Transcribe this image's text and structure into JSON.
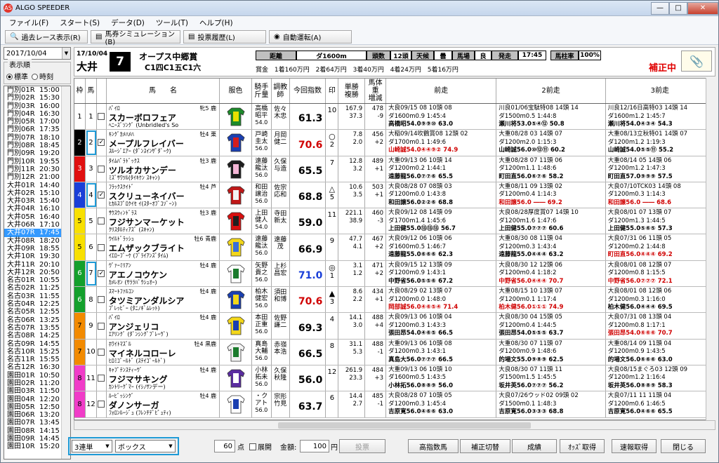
{
  "app": {
    "title": "ALGO SPEEDER",
    "icon": "AS"
  },
  "menu": [
    "ファイル(F)",
    "スタート(S)",
    "データ(D)",
    "ツール(T)",
    "ヘルプ(H)"
  ],
  "toolbar": [
    "過去レース表示(R)",
    "馬券シミュレーション(B)",
    "投票履歴(L)",
    "自動運転(A)"
  ],
  "date": "2017/10/04",
  "order": {
    "label": "表示順",
    "opt1": "標準",
    "opt2": "時刻"
  },
  "races": [
    {
      "c": "門別01R",
      "t": "15:00"
    },
    {
      "c": "門別02R",
      "t": "15:30"
    },
    {
      "c": "門別03R",
      "t": "16:00"
    },
    {
      "c": "門別04R",
      "t": "16:30"
    },
    {
      "c": "門別05R",
      "t": "17:00"
    },
    {
      "c": "門別06R",
      "t": "17:35"
    },
    {
      "c": "門別07R",
      "t": "18:10"
    },
    {
      "c": "門別08R",
      "t": "18:45"
    },
    {
      "c": "門別09R",
      "t": "19:20"
    },
    {
      "c": "門別10R",
      "t": "19:55"
    },
    {
      "c": "門別11R",
      "t": "20:30"
    },
    {
      "c": "門別12R",
      "t": "21:00"
    },
    {
      "c": "大井01R",
      "t": "14:40"
    },
    {
      "c": "大井02R",
      "t": "15:10"
    },
    {
      "c": "大井03R",
      "t": "15:40"
    },
    {
      "c": "大井04R",
      "t": "16:10"
    },
    {
      "c": "大井05R",
      "t": "16:40"
    },
    {
      "c": "大井06R",
      "t": "17:10"
    },
    {
      "c": "大井07R",
      "t": "17:45"
    },
    {
      "c": "大井08R",
      "t": "18:20"
    },
    {
      "c": "大井09R",
      "t": "18:55"
    },
    {
      "c": "大井10R",
      "t": "19:30"
    },
    {
      "c": "大井11R",
      "t": "20:10"
    },
    {
      "c": "大井12R",
      "t": "20:50"
    },
    {
      "c": "名古01R",
      "t": "10:55"
    },
    {
      "c": "名古02R",
      "t": "11:25"
    },
    {
      "c": "名古03R",
      "t": "11:55"
    },
    {
      "c": "名古04R",
      "t": "12:25"
    },
    {
      "c": "名古05R",
      "t": "12:55"
    },
    {
      "c": "名古06R",
      "t": "13:25"
    },
    {
      "c": "名古07R",
      "t": "13:55"
    },
    {
      "c": "名古08R",
      "t": "14:25"
    },
    {
      "c": "名古09R",
      "t": "14:55"
    },
    {
      "c": "名古10R",
      "t": "15:25"
    },
    {
      "c": "名古11R",
      "t": "15:55"
    },
    {
      "c": "名古12R",
      "t": "16:30"
    },
    {
      "c": "園田01R",
      "t": "10:50"
    },
    {
      "c": "園田02R",
      "t": "11:20"
    },
    {
      "c": "園田03R",
      "t": "11:50"
    },
    {
      "c": "園田04R",
      "t": "12:20"
    },
    {
      "c": "園田05R",
      "t": "12:50"
    },
    {
      "c": "園田06R",
      "t": "13:20"
    },
    {
      "c": "園田07R",
      "t": "13:45"
    },
    {
      "c": "園田08R",
      "t": "14:15"
    },
    {
      "c": "園田09R",
      "t": "14:45"
    },
    {
      "c": "園田10R",
      "t": "15:20"
    }
  ],
  "selected_race": "大井07R",
  "race": {
    "date": "17/10/04",
    "venue": "大井",
    "number": "7",
    "name": "オープス中郷賞",
    "cls": "C1四C1五C1六",
    "dist_lbl": "距離",
    "dist": "ダ1600m",
    "heads_lbl": "頭数",
    "heads": "12頭",
    "weather_lbl": "天候",
    "weather": "曇",
    "track_lbl": "馬場",
    "track": "良",
    "start_lbl": "発走",
    "start": "17:45",
    "rate_lbl": "馬柱率",
    "rate": "100%",
    "prize": "賞金 1着160万円 2着64万円 3着40万円 4着24万円 5着16万円",
    "status": "補正中"
  },
  "columns": [
    "枠",
    "馬",
    "",
    "馬　　名",
    "服色",
    "騎手\n斤量",
    "調教師",
    "今回指数",
    "印",
    "単勝\n複勝",
    "馬体重\n増減",
    "前走",
    "2前走",
    "3前走"
  ],
  "horses": [
    {
      "f": "1",
      "n": "1",
      "ck": false,
      "sire": "ﾊﾟｲﾛ",
      "sex": "牝5 鹿",
      "name": "スカーボロフェア",
      "dam": "ﾍﾆｰｽﾞｿﾝｸﾞ (Unbridled's So",
      "j": "高橋\n昭平",
      "w": "54.0",
      "t": "佐々\n木忠",
      "idx": "61.3",
      "mk": "",
      "pop": "10",
      "od1": "167.9",
      "od2": "37.3",
      "bw": "478",
      "bd": "-9",
      "p1a": "大良09/15 08 10頭 08",
      "p1b": "ダ1600m0.9 1:45:4",
      "p1c": "高橋昭54.0⑨⑨⑩ 63.0",
      "p2a": "川良01/06宝駄特08 14頭 14",
      "p2b": "ダ1500m0.5 1:44:8",
      "p2c": "瀬川将53.0⑤④⑫ 50.8",
      "p3a": "川良12/16日高特03 14頭 14",
      "p3b": "ダ1600m1.2 1:45:7",
      "p3c": "瀬川将54.0④③④ 54.3",
      "c1": "",
      "c2": "",
      "c3": "",
      "silk": [
        "#1d8a2a",
        "#e8e000"
      ]
    },
    {
      "f": "2",
      "n": "2",
      "ck": true,
      "sire": "ｷﾝｸﾞｶﾒﾊﾒﾊ",
      "sex": "牡4 栗",
      "name": "メープルフレイバー",
      "dam": "ｽﾙｰｼﾞｴｱｰ (ﾀﾞﾝｽｲﾝｻﾞﾀﾞｰｸ)",
      "j": "戸崎\n圭太",
      "w": "56.0",
      "t": "月岡\n健二",
      "idx": "70.6",
      "mk": "○",
      "pop": "2",
      "od1": "7.8",
      "od2": "2.0",
      "bw": "456",
      "bd": "+2",
      "p1a": "大稲09/14吹鶴賞08 12頭 02",
      "p1b": "ダ1700m0.1 1:49:6",
      "p1c": "山崎誠54.0④④⑨② 74.9",
      "p2a": "大重08/28 03 14頭 07",
      "p2b": "ダ1200m2.0 1:15:3",
      "p2c": "山崎誠56.0⑩⑫⑪ 60.2",
      "p3a": "大重08/13立秋特01 14頭 07",
      "p3b": "ダ1200m1.2 1:19:3",
      "p3c": "山崎誠54.0⑤⑤⑪ 55.2",
      "c1": "red",
      "c2": "",
      "c3": "",
      "silk": [
        "#1a3fb0",
        "#d31d1d"
      ]
    },
    {
      "f": "3",
      "n": "3",
      "ck": false,
      "sire": "ﾀｲﾑﾊﾟﾗﾄﾞｯｸｽ",
      "sex": "牡3 鹿",
      "name": "ツルオカサンデー",
      "dam": "ﾐｽﾞｻﾜﾂﾙ(ﾀｲｷｹﾝ ｽｷｬﾝ)",
      "j": "遠藤\n龍汰",
      "w": "56.0",
      "t": "久保\n与造",
      "idx": "65.5",
      "mk": "",
      "pop": "7",
      "od1": "12.8",
      "od2": "3.2",
      "bw": "489",
      "bd": "+1",
      "p1a": "大重09/13 06 10頭 14",
      "p1b": "ダ1200m0.2 1:44:1",
      "p1c": "遠藤龍56.0⑦⑦⑥ 65.5",
      "p2a": "大重08/28 07 11頭 06",
      "p2b": "ダ1200m1.1 1:48:6",
      "p2c": "町田直56.0⑥⑦⑥ 58.2",
      "p3a": "大重08/14 05 14頭 06",
      "p3b": "ダ1200m1.2 1:47:3",
      "p3c": "町田直57.0⑨⑨⑨ 57.5",
      "c1": "",
      "c2": "",
      "c3": "",
      "silk": [
        "#1d1d1d",
        "#f4b6d6"
      ]
    },
    {
      "f": "4",
      "n": "4",
      "ck": true,
      "sire": "ﾌﾗｯｸｽｸｲﾄﾞ",
      "sex": "牡4 芦",
      "name": "スクリューネイバー",
      "dam": "ﾋｶﾙｽﾌﾟﾛｸｲｾ ｲ(ｽﾀｰｵﾌﾞｺｿﾞｰﾝ)",
      "j": "和田\n譲治",
      "w": "56.0",
      "t": "佐宗\n応和",
      "idx": "68.8",
      "mk": "△",
      "pop": "5",
      "od1": "10.6",
      "od2": "3.5",
      "bw": "503",
      "bd": "+1",
      "p1a": "大良08/28 07 08頭 03",
      "p1b": "ダ1200m0.0 1:43:8",
      "p1c": "和田譲56.0②②⑥ 68.8",
      "p2a": "大重08/11 09 13頭 02",
      "p2b": "ダ1200m0.4 1:14:3",
      "p2c": "和田譲56.0 ―― 69.2",
      "p3a": "大良07/10TCK03 14頭 08",
      "p3b": "ダ1200m0.3 1:14:3",
      "p3c": "和田譲56.0 ―― 68.6",
      "c1": "",
      "c2": "red",
      "c3": "red",
      "silk": [
        "#c01818",
        "#f2f2f2"
      ]
    },
    {
      "f": "5",
      "n": "5",
      "ck": false,
      "sire": "ｻｳｽｳｨﾝﾄﾞﾗｽ",
      "sex": "牡3 鹿",
      "name": "フジサンマーケット",
      "dam": "ｸﾘｽﾀﾙﾃｨｱｽﾞ (ｽｷｬﾝ)",
      "j": "上田\n健人",
      "w": "54.0",
      "t": "寺田\n新太",
      "idx": "59.0",
      "mk": "",
      "pop": "11",
      "od1": "221.1",
      "od2": "38.9",
      "bw": "460",
      "bd": "-3",
      "p1a": "大良09/12 08 14頭 09",
      "p1b": "ダ1700m1.4 1:45:6",
      "p1c": "上田健55.0⑬⑬⑬ 56.7",
      "p2a": "大良08/28厚度賞07 14頭 10",
      "p2b": "ダ1200m1.6 1:47:6",
      "p2c": "上田健55.0⑦⑦⑦ 60.6",
      "p3a": "大良08/01 07 13頭 07",
      "p3b": "ダ1200m1.3 1:44:5",
      "p3c": "上田健55.0⑤⑥⑤ 57.3",
      "c1": "",
      "c2": "",
      "c3": "",
      "silk": [
        "#d81010",
        "#202020"
      ]
    },
    {
      "f": "5",
      "n": "6",
      "ck": false,
      "sire": "ｳｲﾙﾄﾞﾗｯｼｭ",
      "sex": "牡6 青鹿",
      "name": "エムザックブライト",
      "dam": "ｲｴﾛｰﾌﾞｰｹ (ﾌﾞﾗｲｱﾝｽﾞﾀｲﾑ)",
      "j": "遠藤\n龍汰",
      "w": "56.0",
      "t": "遠藤\n茂",
      "idx": "66.9",
      "mk": "",
      "pop": "9",
      "od1": "47.7",
      "od2": "4.1",
      "bw": "467",
      "bd": "+2",
      "p1a": "大良09/12 06 10頭 06",
      "p1b": "ダ1600m0.5 1:46:7",
      "p1c": "遠藤龍55.0⑥⑥⑥ 62.3",
      "p2a": "大重08/30 08 11頭 04",
      "p2b": "ダ1200m0.3 1:43:4",
      "p2c": "遠藤龍55.0④④④ 63.2",
      "p3a": "大良07/31 06 11頭 05",
      "p3b": "ダ1200m0.2 1:44:8",
      "p3c": "町田直56.0④④④ 69.2",
      "c1": "",
      "c2": "",
      "c3": "red",
      "silk": [
        "#f2d61a",
        "#3a6fd8"
      ]
    },
    {
      "f": "6",
      "n": "7",
      "ck": true,
      "sire": "ｳﾞｧｰﾐﾘｱﾝ",
      "sex": "牡4 鹿",
      "name": "アエノコウケン",
      "dam": "ｶﾒﾚｵﾝ (ｻﾗﾗﾊﾞｳｼｭｵｰ)",
      "j": "矢野\n貴之",
      "w": "56.0",
      "t": "上杉\n昌宏",
      "idx": "71.0",
      "mk": "◎",
      "pop": "1",
      "od1": "3.1",
      "od2": "1.2",
      "bw": "471",
      "bd": "+2",
      "p1a": "大良09/15 12 13頭 09",
      "p1b": "ダ1200m0.9 1:43:1",
      "p1c": "中野省56.0⑤⑤⑥ 67.2",
      "p2a": "大良08/30 12 12頭 06",
      "p2b": "ダ1200m0.4 1:18:2",
      "p2c": "中野省56.0④④④ 70.7",
      "p3a": "大良08/01 08 12頭 07",
      "p3b": "ダ1200m0.8 1:15:5",
      "p3c": "中野省56.0⑦⑦⑦ 72.1",
      "c1": "",
      "c2": "red",
      "c3": "red",
      "silk": [
        "#ffffff",
        "#1b7b2d"
      ]
    },
    {
      "f": "6",
      "n": "8",
      "ck": false,
      "sire": "ｽﾏｰﾄﾌｧﾙｺﾝ",
      "sex": "牡4 鹿",
      "name": "タツミアンダルシア",
      "dam": "ﾌﾟﾚｯﾋﾞｰ (ﾀﾆﾉｷﾞﾑﾚｯﾄ)",
      "j": "柏木\n健宏",
      "w": "56.0",
      "t": "須田\n和博",
      "idx": "70.6",
      "mk": "▲",
      "pop": "3",
      "od1": "8.6",
      "od2": "2.2",
      "bw": "434",
      "bd": "+1",
      "p1a": "大良08/29 02 13頭 07",
      "p1b": "ダ1200m0.0 1:48:0",
      "p1c": "岡部誠56.0④⑥⑤④ 71.4",
      "p2a": "大重08/15 10 13頭 07",
      "p2b": "ダ1200m0.1 1:17:4",
      "p2c": "柏木健56.0①①① 74.9",
      "p3a": "大良08/01 08 12頭 06",
      "p3b": "ダ1200m0.3 1:16:0",
      "p3c": "柏木健56.0④④④ 69.5",
      "c1": "red",
      "c2": "red",
      "c3": "",
      "silk": [
        "#1a3fb0",
        "#f2d61a"
      ]
    },
    {
      "f": "7",
      "n": "9",
      "ck": false,
      "sire": "ﾊﾟｲﾛ",
      "sex": "牡4 鹿",
      "name": "アンジェリコ",
      "dam": "ｴｱﾘﾝｸﾞ (ﾀﾞﾝｼﾝｸﾞﾌﾞﾚｰｳﾞ)",
      "j": "本田\n正重",
      "w": "56.0",
      "t": "佐野\n謙二",
      "idx": "69.3",
      "mk": "",
      "pop": "4",
      "od1": "14.1",
      "od2": "3.0",
      "bw": "488",
      "bd": "+4",
      "p1a": "大良09/13 06 10頭 04",
      "p1b": "ダ1200m0.3 1:43:3",
      "p1c": "張田昂54.0④⑥⑤ 66.5",
      "p2a": "大良08/30 04 15頭 05",
      "p2b": "ダ1200m0.4 1:44:5",
      "p2c": "張田昂54.0⑤⑤⑤ 63.7",
      "p3a": "大良07/31 08 13頭 04",
      "p3b": "ダ1200m0.8 1:17:1",
      "p3c": "張田昂54.0⑥⑥⑥ 70.7",
      "c1": "",
      "c2": "",
      "c3": "red",
      "silk": [
        "#f2d61a",
        "#1a3fb0"
      ]
    },
    {
      "f": "7",
      "n": "10",
      "ck": false,
      "sire": "ﾎﾜｲﾄﾏｽﾞﾙ",
      "sex": "牡4 黒鹿",
      "name": "マイネルコローレ",
      "dam": "ﾋﾛﾐｺﾞｰﾙﾄﾞ (ｽﾃｲｺﾞｰﾙﾄﾞ)",
      "j": "真島\n大輔",
      "w": "56.0",
      "t": "赤嶺\n本浩",
      "idx": "66.5",
      "mk": "",
      "pop": "8",
      "od1": "31.1",
      "od2": "5.3",
      "bw": "488",
      "bd": "-1",
      "p1a": "大重09/13 06 10頭 08",
      "p1b": "ダ1200m0.3 1:43:1",
      "p1c": "真島大56.0⑦⑦⑦ 66.5",
      "p2a": "大重08/30 07 11頭 07",
      "p2b": "ダ1200m0.9 1:48:6",
      "p2c": "的場文55.0⑨⑧⑨ 62.5",
      "p3a": "大重08/14 09 11頭 04",
      "p3b": "ダ1200m0.9 1:43:5",
      "p3c": "的場文56.0⑥⑥⑥ 63.0",
      "c1": "",
      "c2": "",
      "c3": "",
      "silk": [
        "#f2f2f2",
        "#1b7b2d"
      ]
    },
    {
      "f": "8",
      "n": "11",
      "ck": false,
      "sire": "ｷｬﾌﾟﾃﾝｽﾃｨｰｳﾞ",
      "sex": "牡4 鹿",
      "name": "フジマサキング",
      "dam": "ｶﾝﾄﾘｰｸﾞﾏｰ (ｲｼﾉｻﾝデー)",
      "j": "小林\n拓未",
      "w": "56.0",
      "t": "久保\n秋隆",
      "idx": "56.0",
      "mk": "",
      "pop": "12",
      "od1": "261.9",
      "od2": "23.3",
      "bw": "484",
      "bd": "+3",
      "p1a": "大重09/13 06 10頭 10",
      "p1b": "ダ1600m0.5 1:43:5",
      "p1c": "小林拓56.0⑧⑧⑨ 56.0",
      "p2a": "大良08/30 07 11頭 11",
      "p2b": "ダ1500m1.5 1:45:5",
      "p2c": "坂井英56.0⑦⑦⑦ 56.2",
      "p3a": "大良08/15まぐろ03 12頭 09",
      "p3b": "ダ1200m1.2 1:16:4",
      "p3c": "坂井英56.0⑧⑧⑨ 58.3",
      "c1": "",
      "c2": "",
      "c3": "",
      "silk": [
        "#5a2ca0",
        "#ffffff"
      ]
    },
    {
      "f": "8",
      "n": "12",
      "ck": false,
      "sire": "ﾙｰﾋﾞｯｼﾝｸﾞ",
      "sex": "牡4 鹿",
      "name": "ダノンサーガ",
      "dam": "ﾌｫﾛﾝﾙｰｼﾞｭ (ﾌﾚﾝﾁﾃﾞﾋﾟｭﾃｨ)",
      "j": "・ク\nアト",
      "w": "56.0",
      "t": "宗形\n竹見",
      "idx": "63.7",
      "mk": "",
      "pop": "6",
      "od1": "14.4",
      "od2": "2.7",
      "bw": "485",
      "bd": "-1",
      "p1a": "大良08/28 07 10頭 05",
      "p1b": "ダ1200m0.3 1:45:4",
      "p1c": "吉原寛56.0④⑥⑥ 63.0",
      "p2a": "大良07/26ウッド02 09頭 02",
      "p2b": "ダ1500m0.1 1:48:3",
      "p2c": "吉原寛56.0③③③ 68.8",
      "p3a": "大良07/11 11 11頭 04",
      "p3b": "ダ1200m0.6 1:46:5",
      "p3c": "吉原寛56.0④⑥⑥ 65.5",
      "c1": "",
      "c2": "",
      "c3": "",
      "silk": [
        "#ffffff",
        "#1a3fb0"
      ]
    }
  ],
  "frame_colors": {
    "1": [
      "#ffffff",
      "#000"
    ],
    "2": [
      "#000000",
      "#fff"
    ],
    "3": [
      "#e01010",
      "#fff"
    ],
    "4": [
      "#1a3fd8",
      "#fff"
    ],
    "5": [
      "#f8e000",
      "#000"
    ],
    "6": [
      "#14a02c",
      "#fff"
    ],
    "7": [
      "#f28a00",
      "#000"
    ],
    "8": [
      "#f03cc8",
      "#000"
    ]
  },
  "bottom": {
    "bet_type": "3連単",
    "bet_method": "ボックス",
    "points": "60",
    "points_lbl": "点",
    "expand_lbl": "展開",
    "amount_lbl": "金額:",
    "amount": "100",
    "amount_unit": "円",
    "vote": "投票",
    "btn1": "高指数馬",
    "btn2": "補正切替",
    "btn3": "成績",
    "btn4": "ｵｯｽﾞ取得",
    "btn5": "速報取得",
    "btn6": "閉じる"
  }
}
